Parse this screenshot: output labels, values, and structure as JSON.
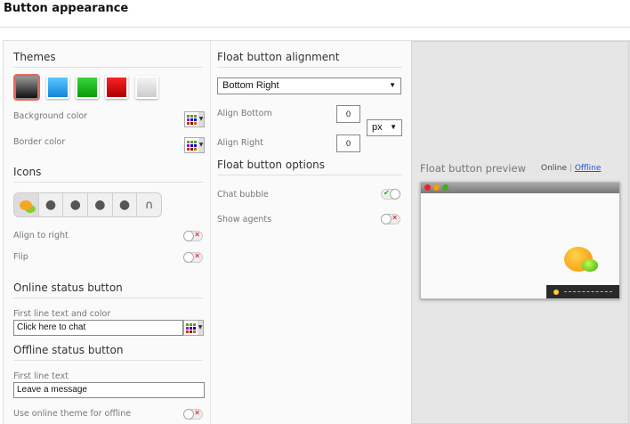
{
  "title": "Button appearance",
  "themes": {
    "heading": "Themes",
    "swatches": [
      "#333333",
      "#2a9be0",
      "#1aa61a",
      "#c81414",
      "#d8d8d8"
    ],
    "selected": 0,
    "background_color_label": "Background color",
    "border_color_label": "Border color"
  },
  "icons": {
    "heading": "Icons",
    "items": [
      "chat-bubbles-icon",
      "agent-1-icon",
      "agent-2-icon",
      "agent-3-icon",
      "agent-4-icon",
      "headset-icon"
    ],
    "align_right_label": "Align to right",
    "flip_label": "Flip"
  },
  "online": {
    "heading": "Online status button",
    "first_line_label": "First line text and color",
    "first_line_value": "Click here to chat"
  },
  "offline": {
    "heading": "Offline status button",
    "first_line_label": "First line text",
    "first_line_value": "Leave a message",
    "use_online_theme_label": "Use online theme for offline"
  },
  "alignment": {
    "heading": "Float button alignment",
    "position": "Bottom Right",
    "align_bottom_label": "Align Bottom",
    "align_bottom_value": "0",
    "align_right_label": "Align Right",
    "align_right_value": "0",
    "unit": "px"
  },
  "options": {
    "heading": "Float button options",
    "chat_bubble_label": "Chat bubble",
    "chat_bubble_on": true,
    "show_agents_label": "Show agents",
    "show_agents_on": false
  },
  "preview": {
    "heading": "Float button preview",
    "online_label": "Online",
    "separator": "|",
    "offline_label": "Offline"
  }
}
